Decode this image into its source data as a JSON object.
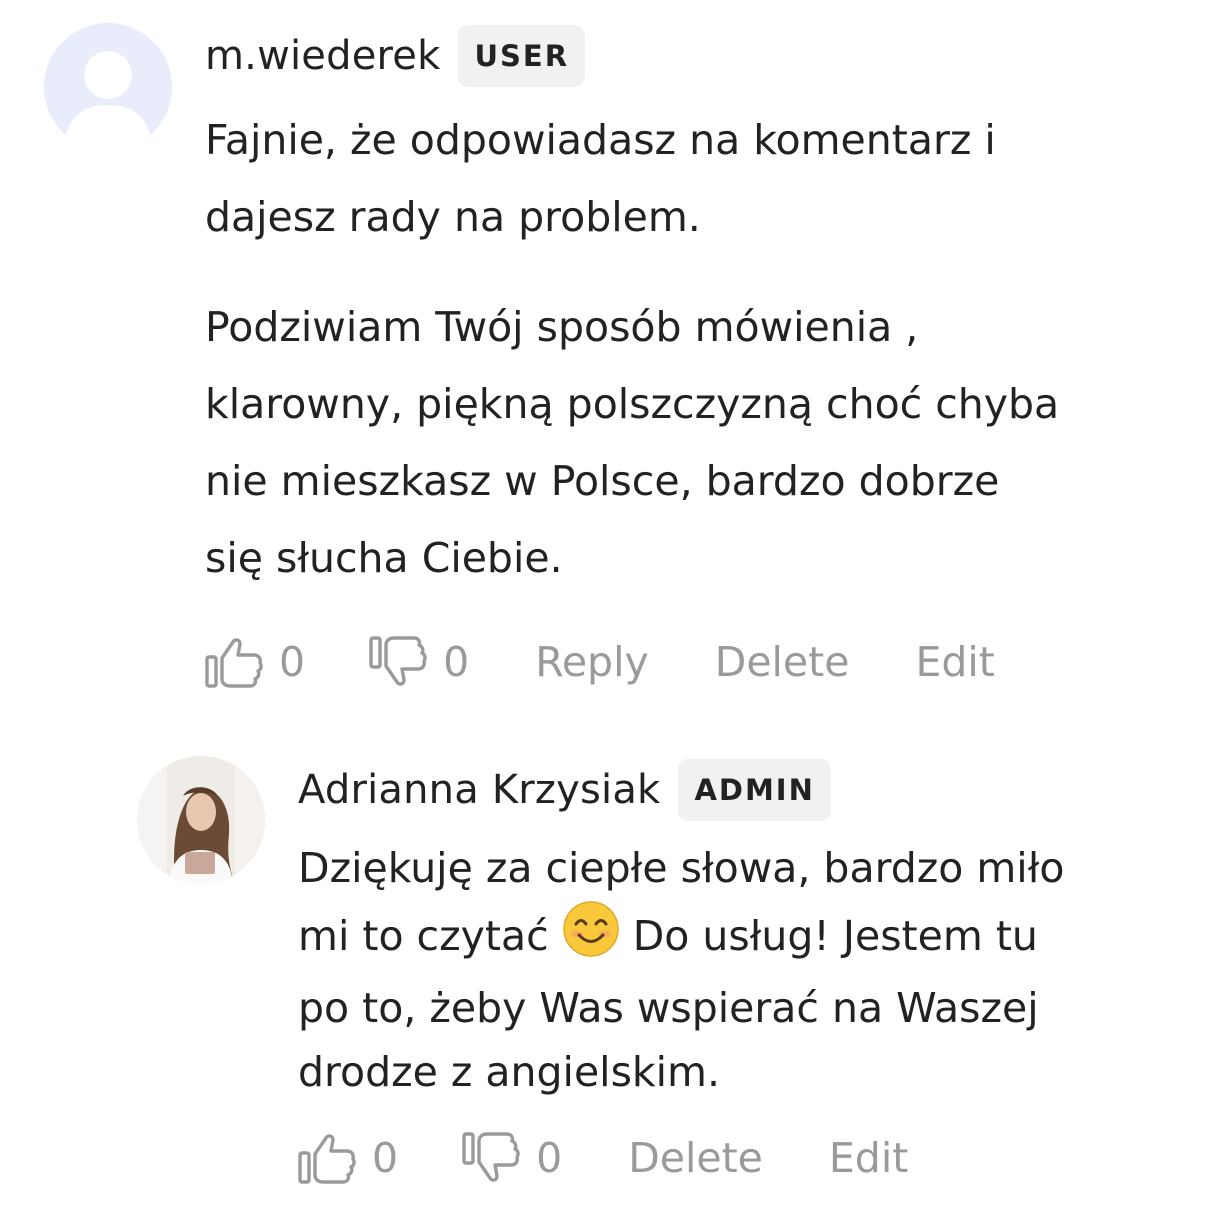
{
  "comments": [
    {
      "author": "m.wiederek",
      "role_badge": "USER",
      "paragraphs": [
        [
          "Fajnie, że odpowiadasz na komentarz i",
          "dajesz rady na problem."
        ],
        [
          "Podziwiam Twój sposób mówienia ,",
          "klarowny, piękną polszczyzną choć chyba",
          "nie mieszkasz w Polsce, bardzo dobrze",
          "się słucha Ciebie."
        ]
      ],
      "likes": "0",
      "dislikes": "0",
      "actions": {
        "reply": "Reply",
        "delete": "Delete",
        "edit": "Edit"
      }
    },
    {
      "author": "Adrianna Krzysiak",
      "role_badge": "ADMIN",
      "lines": {
        "l1": "Dziękuję za ciepłe słowa, bardzo miło",
        "l2a": "mi to czytać",
        "l2b": "Do usług! Jestem tu",
        "l3": "po to, żeby Was wspierać na Waszej",
        "l4": "drodze z angielskim."
      },
      "likes": "0",
      "dislikes": "0",
      "actions": {
        "delete": "Delete",
        "edit": "Edit"
      }
    }
  ],
  "icons": {
    "like": "thumbs-up-icon",
    "dislike": "thumbs-down-icon",
    "emoji": "smiling-face-emoji"
  },
  "colors": {
    "text": "#222222",
    "muted": "#9a9a9a",
    "badge_bg": "#f1f1f1",
    "avatar_placeholder": "#e8ecfb"
  }
}
